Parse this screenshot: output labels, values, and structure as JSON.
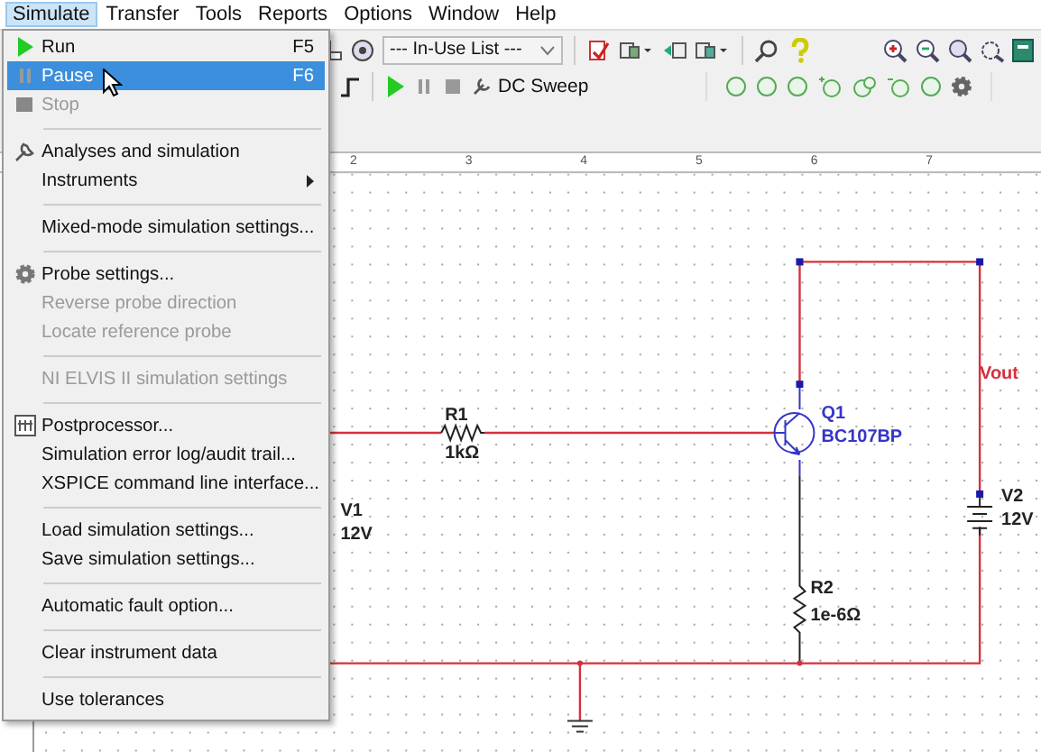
{
  "menu_bar": [
    {
      "label": "Simulate",
      "selected": true
    },
    {
      "label": "Transfer",
      "selected": false
    },
    {
      "label": "Tools",
      "selected": false
    },
    {
      "label": "Reports",
      "selected": false
    },
    {
      "label": "Options",
      "selected": false
    },
    {
      "label": "Window",
      "selected": false
    },
    {
      "label": "Help",
      "selected": false
    }
  ],
  "toolbar": {
    "dropdown": "--- In-Use List ---",
    "analysis": "DC Sweep"
  },
  "ruler": [
    "2",
    "3",
    "4",
    "5",
    "6",
    "7"
  ],
  "menu": [
    {
      "kind": "item",
      "label": "Run",
      "shortcut": "F5",
      "disabled": false,
      "selected": false
    },
    {
      "kind": "item",
      "label": "Pause",
      "shortcut": "F6",
      "disabled": false,
      "selected": true
    },
    {
      "kind": "item",
      "label": "Stop",
      "disabled": true,
      "selected": false
    },
    {
      "kind": "separator"
    },
    {
      "kind": "item",
      "label": "Analyses and simulation",
      "disabled": false,
      "selected": false
    },
    {
      "kind": "item",
      "label": "Instruments",
      "submenu": true,
      "disabled": false,
      "selected": false
    },
    {
      "kind": "separator"
    },
    {
      "kind": "item",
      "label": "Mixed-mode simulation settings...",
      "disabled": false,
      "selected": false
    },
    {
      "kind": "separator"
    },
    {
      "kind": "item",
      "label": "Probe settings...",
      "disabled": false,
      "selected": false
    },
    {
      "kind": "item",
      "label": "Reverse probe direction",
      "disabled": true,
      "selected": false
    },
    {
      "kind": "item",
      "label": "Locate reference probe",
      "disabled": true,
      "selected": false
    },
    {
      "kind": "separator"
    },
    {
      "kind": "item",
      "label": "NI ELVIS II simulation settings",
      "disabled": true,
      "selected": false
    },
    {
      "kind": "separator"
    },
    {
      "kind": "item",
      "label": "Postprocessor...",
      "disabled": false,
      "selected": false
    },
    {
      "kind": "item",
      "label": "Simulation error log/audit trail...",
      "disabled": false,
      "selected": false
    },
    {
      "kind": "item",
      "label": "XSPICE command line interface...",
      "disabled": false,
      "selected": false
    },
    {
      "kind": "separator"
    },
    {
      "kind": "item",
      "label": "Load simulation settings...",
      "disabled": false,
      "selected": false
    },
    {
      "kind": "item",
      "label": "Save simulation settings...",
      "disabled": false,
      "selected": false
    },
    {
      "kind": "separator"
    },
    {
      "kind": "item",
      "label": "Automatic fault option...",
      "disabled": false,
      "selected": false
    },
    {
      "kind": "separator"
    },
    {
      "kind": "item",
      "label": "Clear instrument data",
      "disabled": false,
      "selected": false
    },
    {
      "kind": "separator"
    },
    {
      "kind": "item",
      "label": "Use tolerances",
      "disabled": false,
      "selected": false
    }
  ],
  "schematic": {
    "r1": {
      "name": "R1",
      "value": "1kΩ"
    },
    "q1": {
      "name": "Q1",
      "value": "BC107BP"
    },
    "v1": {
      "name": "V1",
      "value": "12V"
    },
    "v2": {
      "name": "V2",
      "value": "12V"
    },
    "r2": {
      "name": "R2",
      "value": "1e-6Ω"
    },
    "probe": "Vout"
  }
}
